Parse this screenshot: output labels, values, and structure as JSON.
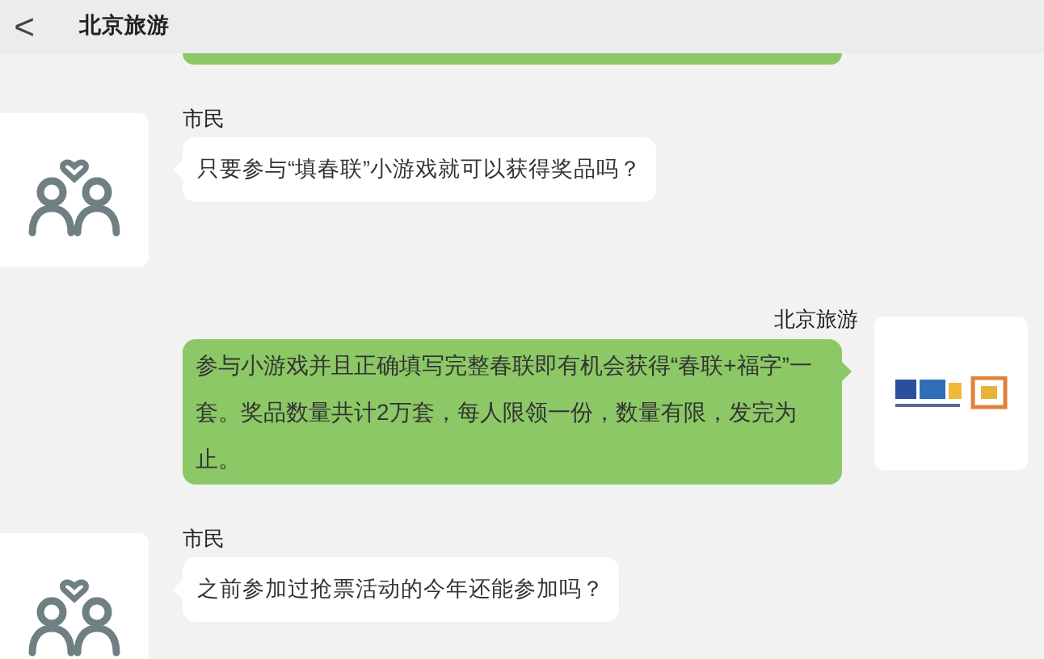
{
  "header": {
    "back": "<",
    "title": "北京旅游"
  },
  "messages": [
    {
      "kind": "outgoing-cut"
    },
    {
      "kind": "incoming",
      "sender": "市民",
      "text": "只要参与“填春联”小游戏就可以获得奖品吗？"
    },
    {
      "kind": "outgoing",
      "sender": "北京旅游",
      "text": "参与小游戏并且正确填写完整春联即有机会获得“春联+福字”一套。奖品数量共计2万套，每人限领一份，数量有限，发完为止。"
    },
    {
      "kind": "incoming",
      "sender": "市民",
      "text": "之前参加过抢票活动的今年还能参加吗？"
    }
  ]
}
